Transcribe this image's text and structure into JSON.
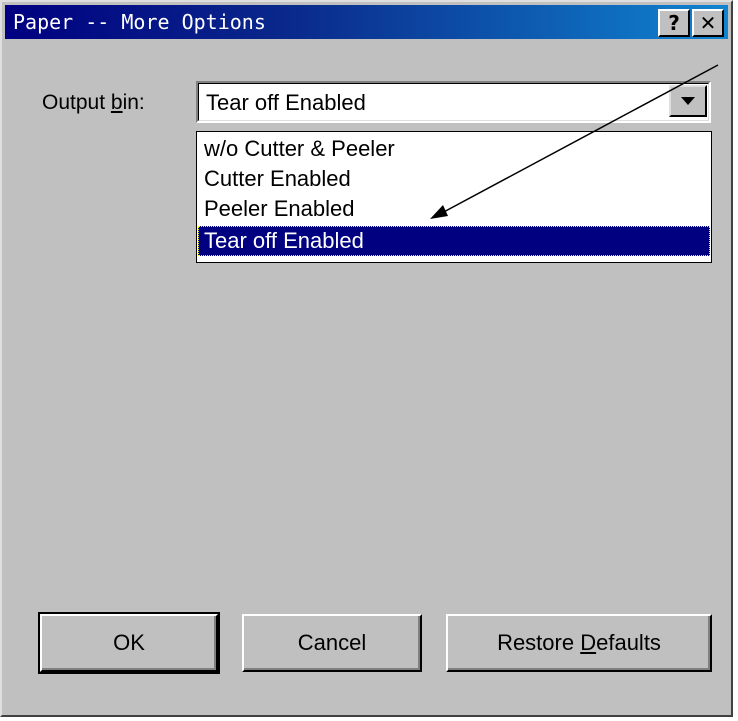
{
  "window": {
    "title": "Paper -- More Options"
  },
  "titlebar": {
    "help_label": "?",
    "close_label": "✕"
  },
  "output_bin": {
    "label_pre": "Output ",
    "label_mnemonic": "b",
    "label_post": "in:",
    "selected_value": "Tear off Enabled",
    "options": [
      "w/o Cutter & Peeler",
      "Cutter Enabled",
      "Peeler Enabled",
      "Tear off Enabled"
    ],
    "selected_index": 3
  },
  "buttons": {
    "ok": "OK",
    "cancel": "Cancel",
    "restore_pre": "Restore ",
    "restore_mnemonic": "D",
    "restore_post": "efaults"
  },
  "colors": {
    "titlebar_start": "#000080",
    "titlebar_end": "#1084d0",
    "selection": "#000080",
    "face": "#c0c0c0"
  }
}
